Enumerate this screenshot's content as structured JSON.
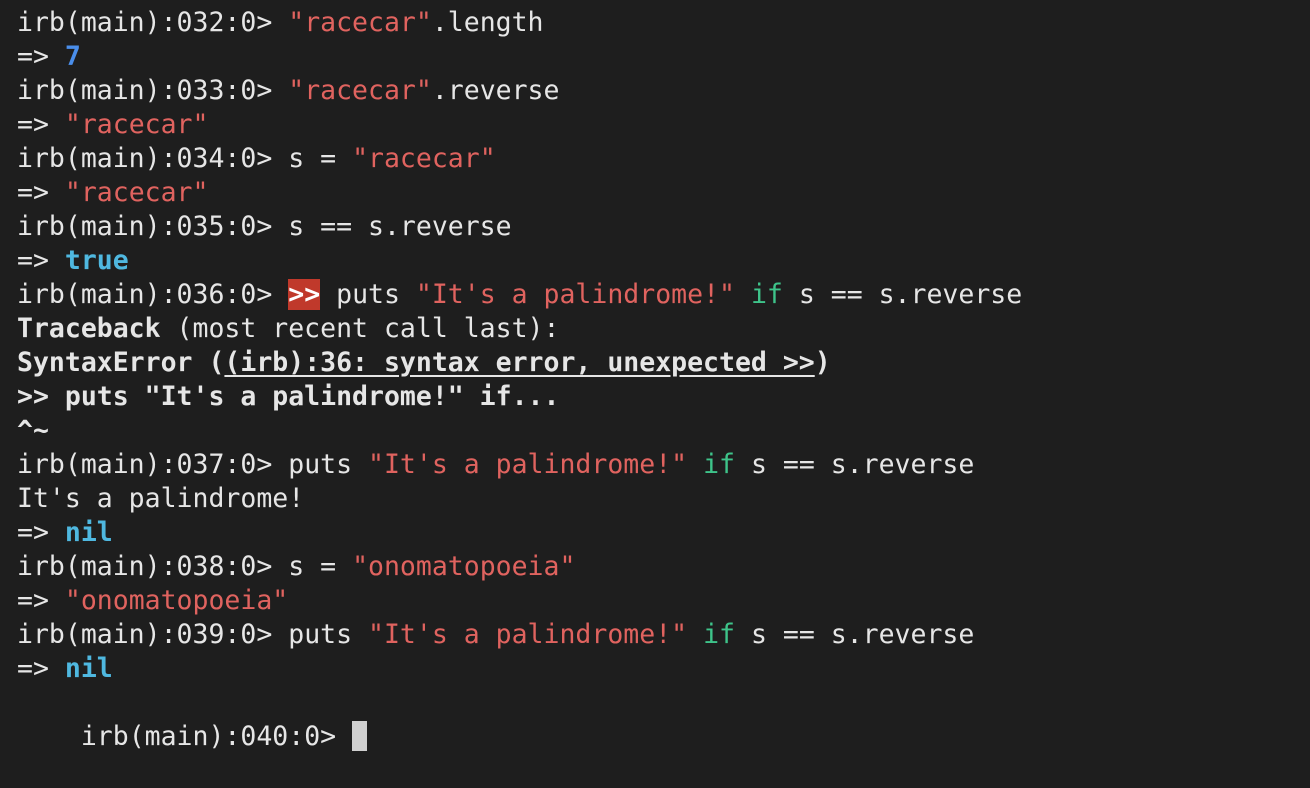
{
  "terminal": {
    "lines": [
      [
        {
          "text": "irb(main):032:0> ",
          "style": "plain"
        },
        {
          "text": "\"racecar\"",
          "style": "str"
        },
        {
          "text": ".length",
          "style": "plain"
        }
      ],
      [
        {
          "text": "=> ",
          "style": "plain"
        },
        {
          "text": "7",
          "style": "num"
        }
      ],
      [
        {
          "text": "irb(main):033:0> ",
          "style": "plain"
        },
        {
          "text": "\"racecar\"",
          "style": "str"
        },
        {
          "text": ".reverse",
          "style": "plain"
        }
      ],
      [
        {
          "text": "=> ",
          "style": "plain"
        },
        {
          "text": "\"racecar\"",
          "style": "str"
        }
      ],
      [
        {
          "text": "irb(main):034:0> ",
          "style": "plain"
        },
        {
          "text": "s = ",
          "style": "plain"
        },
        {
          "text": "\"racecar\"",
          "style": "str"
        }
      ],
      [
        {
          "text": "=> ",
          "style": "plain"
        },
        {
          "text": "\"racecar\"",
          "style": "str"
        }
      ],
      [
        {
          "text": "irb(main):035:0> ",
          "style": "plain"
        },
        {
          "text": "s == s.reverse",
          "style": "plain"
        }
      ],
      [
        {
          "text": "=> ",
          "style": "plain"
        },
        {
          "text": "true",
          "style": "const"
        }
      ],
      [
        {
          "text": "irb(main):036:0> ",
          "style": "plain"
        },
        {
          "text": ">>",
          "style": "err"
        },
        {
          "text": " puts ",
          "style": "plain"
        },
        {
          "text": "\"It's a palindrome!\"",
          "style": "str"
        },
        {
          "text": " ",
          "style": "plain"
        },
        {
          "text": "if",
          "style": "kw"
        },
        {
          "text": " s == s.reverse",
          "style": "plain"
        }
      ],
      [
        {
          "text": "Traceback",
          "style": "bold"
        },
        {
          "text": " (most recent call last):",
          "style": "plain"
        }
      ],
      [
        {
          "text": "SyntaxError (",
          "style": "bold"
        },
        {
          "text": "(irb):36: syntax error, unexpected >>",
          "style": "boldul"
        },
        {
          "text": ")",
          "style": "bold"
        }
      ],
      [
        {
          "text": ">> puts \"It's a palindrome!\" if...",
          "style": "bold"
        }
      ],
      [
        {
          "text": "^~",
          "style": "bold"
        }
      ],
      [
        {
          "text": "irb(main):037:0> ",
          "style": "plain"
        },
        {
          "text": "puts ",
          "style": "plain"
        },
        {
          "text": "\"It's a palindrome!\"",
          "style": "str"
        },
        {
          "text": " ",
          "style": "plain"
        },
        {
          "text": "if",
          "style": "kw"
        },
        {
          "text": " s == s.reverse",
          "style": "plain"
        }
      ],
      [
        {
          "text": "It's a palindrome!",
          "style": "plain"
        }
      ],
      [
        {
          "text": "=> ",
          "style": "plain"
        },
        {
          "text": "nil",
          "style": "const"
        }
      ],
      [
        {
          "text": "irb(main):038:0> ",
          "style": "plain"
        },
        {
          "text": "s = ",
          "style": "plain"
        },
        {
          "text": "\"onomatopoeia\"",
          "style": "str"
        }
      ],
      [
        {
          "text": "=> ",
          "style": "plain"
        },
        {
          "text": "\"onomatopoeia\"",
          "style": "str"
        }
      ],
      [
        {
          "text": "irb(main):039:0> ",
          "style": "plain"
        },
        {
          "text": "puts ",
          "style": "plain"
        },
        {
          "text": "\"It's a palindrome!\"",
          "style": "str"
        },
        {
          "text": " ",
          "style": "plain"
        },
        {
          "text": "if",
          "style": "kw"
        },
        {
          "text": " s == s.reverse",
          "style": "plain"
        }
      ],
      [
        {
          "text": "=> ",
          "style": "plain"
        },
        {
          "text": "nil",
          "style": "const"
        }
      ]
    ],
    "prompt": {
      "text": "irb(main):040:0> ",
      "input_value": ""
    }
  },
  "colors": {
    "background": "#1e1e1e",
    "foreground": "#e6e6e6",
    "string": "#e0635f",
    "number": "#4a8eea",
    "keyword": "#3ec48a",
    "constant": "#4fb8e0",
    "error_highlight": "#c0392b",
    "cursor": "#d0d0d0"
  }
}
